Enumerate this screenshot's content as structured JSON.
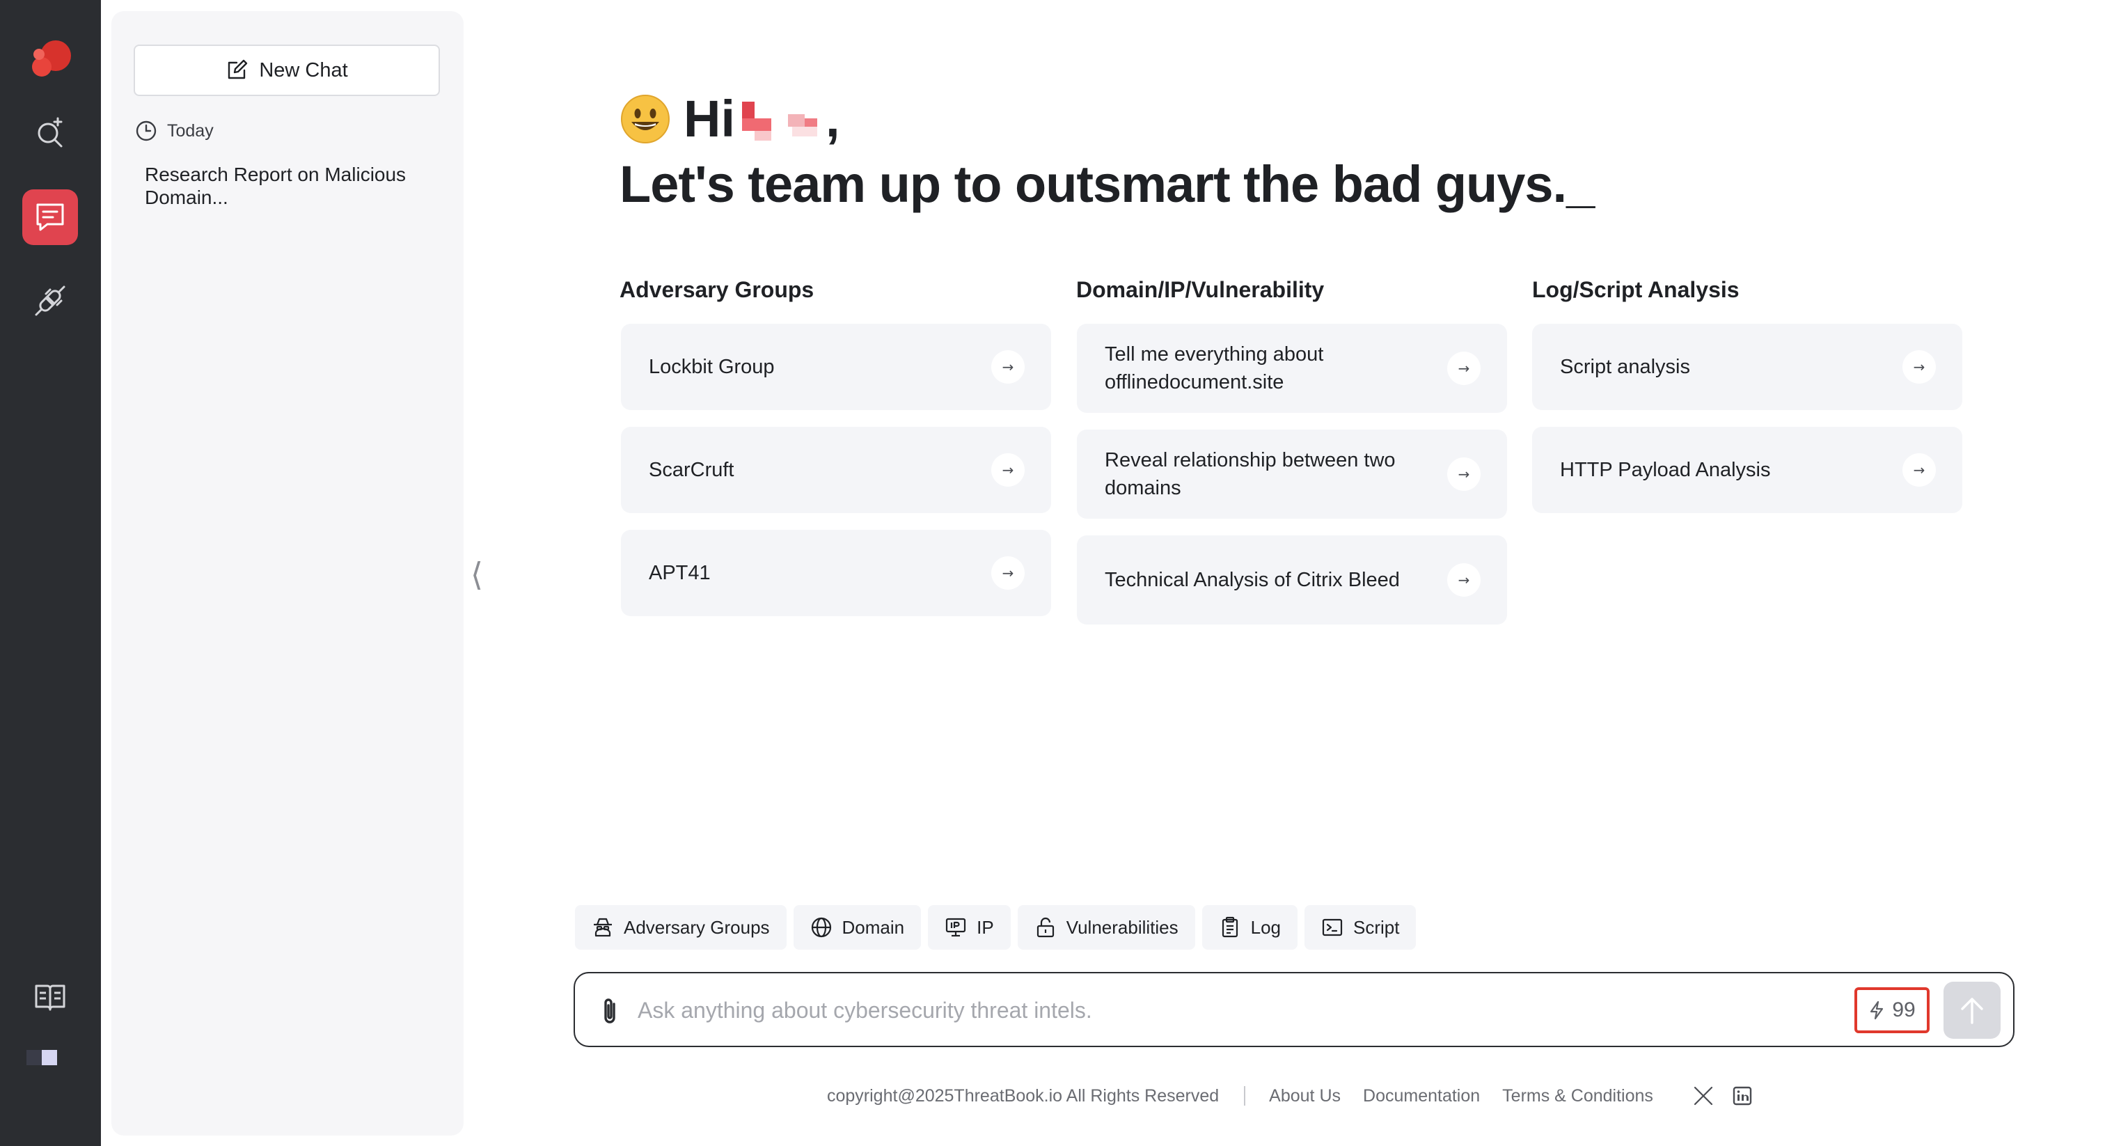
{
  "sidebar": {
    "new_chat_label": "New Chat",
    "section_label": "Today",
    "history": [
      "Research Report on Malicious Domain..."
    ]
  },
  "greeting": {
    "hi": "Hi",
    "comma": ",",
    "headline": "Let's team up to outsmart the bad guys._"
  },
  "columns": [
    {
      "title": "Adversary Groups",
      "items": [
        "Lockbit Group",
        "ScarCruft",
        "APT41"
      ]
    },
    {
      "title": "Domain/IP/Vulnerability",
      "items": [
        "Tell me everything about offlinedocument.site",
        "Reveal relationship between two domains",
        "Technical Analysis of Citrix Bleed"
      ]
    },
    {
      "title": "Log/Script Analysis",
      "items": [
        "Script analysis",
        "HTTP Payload Analysis"
      ]
    }
  ],
  "chips": [
    {
      "label": "Adversary Groups",
      "icon": "spy-icon"
    },
    {
      "label": "Domain",
      "icon": "globe-icon"
    },
    {
      "label": "IP",
      "icon": "ip-monitor-icon"
    },
    {
      "label": "Vulnerabilities",
      "icon": "unlock-icon"
    },
    {
      "label": "Log",
      "icon": "clipboard-icon"
    },
    {
      "label": "Script",
      "icon": "terminal-icon"
    }
  ],
  "input": {
    "placeholder": "Ask anything about cybersecurity threat intels.",
    "credits": "99"
  },
  "footer": {
    "copyright": "copyright@2025ThreatBook.io All Rights Reserved",
    "links": [
      "About Us",
      "Documentation",
      "Terms & Conditions"
    ]
  },
  "colors": {
    "accent": "#e0444f",
    "rail_bg": "#2b2d31",
    "credits_border": "#e0382c"
  }
}
